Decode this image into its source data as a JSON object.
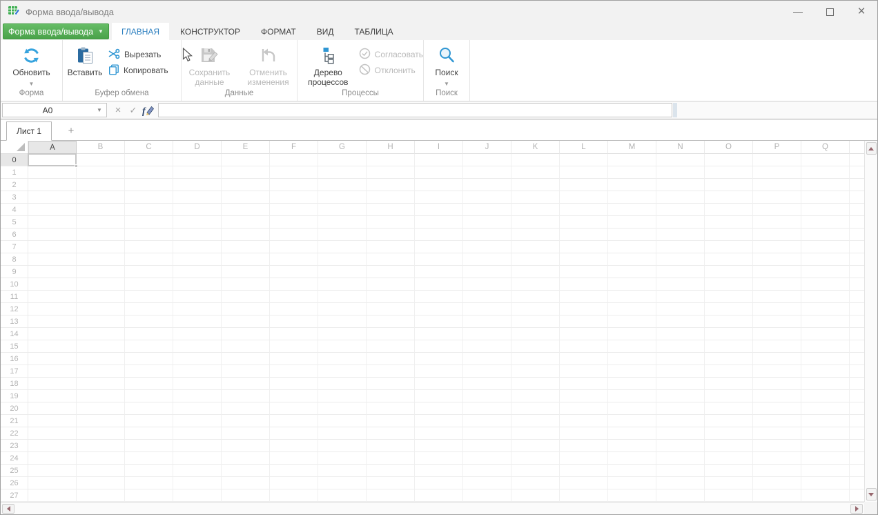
{
  "titlebar": {
    "title": "Форма ввода/вывода",
    "controls": {
      "minimize": "—",
      "close": "×"
    }
  },
  "nav": {
    "app_button": {
      "label": "Форма ввода/вывода",
      "caret": "▼"
    },
    "tabs": [
      {
        "label": "ГЛАВНАЯ",
        "active": true
      },
      {
        "label": "КОНСТРУКТОР",
        "active": false
      },
      {
        "label": "ФОРМАТ",
        "active": false
      },
      {
        "label": "ВИД",
        "active": false
      },
      {
        "label": "ТАБЛИЦА",
        "active": false
      }
    ]
  },
  "ribbon": {
    "groups": [
      {
        "label": "Форма"
      },
      {
        "label": "Буфер обмена"
      },
      {
        "label": "Данные"
      },
      {
        "label": "Процессы"
      },
      {
        "label": "Поиск"
      }
    ],
    "buttons": {
      "refresh": {
        "label": "Обновить",
        "icon": "refresh-icon",
        "enabled": true,
        "has_dropdown": true,
        "caret": "▼"
      },
      "paste": {
        "label": "Вставить",
        "icon": "paste-icon",
        "enabled": true
      },
      "cut": {
        "label": "Вырезать",
        "icon": "scissors-icon",
        "enabled": true
      },
      "copy": {
        "label": "Копировать",
        "icon": "copy-icon",
        "enabled": true
      },
      "save_data": {
        "label": "Сохранить данные",
        "icon": "save-icon",
        "enabled": false
      },
      "undo_changes": {
        "label": "Отменить изменения",
        "icon": "undo-icon",
        "enabled": false
      },
      "process_tree": {
        "label": "Дерево процессов",
        "icon": "tree-icon",
        "enabled": true
      },
      "approve": {
        "label": "Согласовать",
        "icon": "approve-icon",
        "enabled": false
      },
      "reject": {
        "label": "Отклонить",
        "icon": "reject-icon",
        "enabled": false
      },
      "search": {
        "label": "Поиск",
        "icon": "search-icon",
        "enabled": true,
        "has_dropdown": true,
        "caret": "▼"
      }
    }
  },
  "formula_bar": {
    "cell_ref": "A0",
    "cell_ref_caret": "▼",
    "cancel_glyph": "×",
    "confirm_glyph": "✓",
    "formula_value": ""
  },
  "sheet_tabs": {
    "tabs": [
      {
        "label": "Лист 1",
        "active": true
      }
    ],
    "add_label": "+"
  },
  "grid": {
    "columns": [
      "A",
      "B",
      "C",
      "D",
      "E",
      "F",
      "G",
      "H",
      "I",
      "J",
      "K",
      "L",
      "M",
      "N",
      "O",
      "P",
      "Q"
    ],
    "rows": [
      0,
      1,
      2,
      3,
      4,
      5,
      6,
      7,
      8,
      9,
      10,
      11,
      12,
      13,
      14,
      15,
      16,
      17,
      18,
      19,
      20,
      21,
      22,
      23,
      24,
      25,
      26,
      27
    ],
    "selected_cell": {
      "column": "A",
      "row": 0
    }
  },
  "colors": {
    "accent_green": "#4aa24a",
    "active_tab_blue": "#2e80c0",
    "icon_blue": "#2f96d3",
    "disabled_gray": "#b9b9b9",
    "grid_line": "#ececec",
    "header_highlight": "#e7e7e7",
    "selection_border": "#c6c6c6",
    "scroll_arrow": "#96666d"
  }
}
